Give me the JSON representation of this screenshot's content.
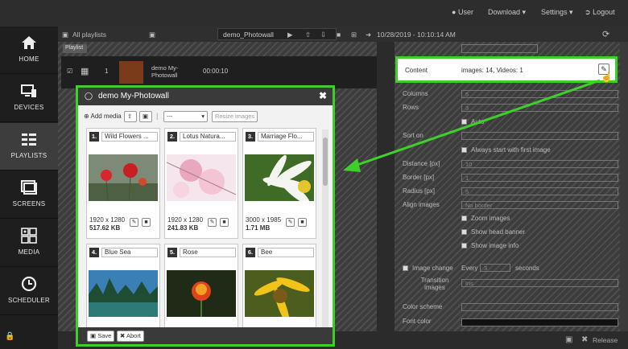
{
  "topnav": {
    "user": "User",
    "download": "Download",
    "settings": "Settings",
    "logout": "Logout"
  },
  "sidebar": [
    {
      "label": "HOME",
      "icon": "home-icon"
    },
    {
      "label": "DEVICES",
      "icon": "devices-icon"
    },
    {
      "label": "PLAYLISTS",
      "icon": "playlists-icon"
    },
    {
      "label": "SCREENS",
      "icon": "screens-icon"
    },
    {
      "label": "MEDIA",
      "icon": "media-icon"
    },
    {
      "label": "SCHEDULER",
      "icon": "scheduler-icon"
    }
  ],
  "toolbar": {
    "all_playlists": "All playlists",
    "playlist_name": "demo_Photowall",
    "datetime": "10/28/2019 - 10:10:14 AM"
  },
  "playlist": {
    "tag": "Playlist",
    "row": {
      "index": "1",
      "name": "demo My-Photowall",
      "duration": "00:00:10"
    }
  },
  "content_panel": {
    "content_label": "Content",
    "content_value": "images: 14, Videos: 1",
    "fields": [
      {
        "label": "Columns",
        "value": "5"
      },
      {
        "label": "Rows",
        "value": "3"
      },
      {
        "label": "Sort on",
        "value": ""
      },
      {
        "label": "Distance [px]",
        "value": "10"
      },
      {
        "label": "Border [px]",
        "value": "1"
      },
      {
        "label": "Radius [px]",
        "value": "5"
      },
      {
        "label": "Align images",
        "value": "No border"
      }
    ],
    "checks": {
      "auto": "Auto",
      "first_image": "Always start with first image",
      "zoom": "Zoom images",
      "banner": "Show head banner",
      "info": "Show image info"
    },
    "image_change": {
      "label": "Image change",
      "every": "Every",
      "value": "3",
      "unit": "seconds"
    },
    "transition": {
      "label": "Transition images",
      "value": "Ins"
    },
    "color_scheme": "Color scheme",
    "font_color": "Font color"
  },
  "modal": {
    "title": "demo My-Photowall",
    "add_media": "Add media",
    "select_value": "---",
    "resize": "Resize images",
    "cards": [
      {
        "num": "1.",
        "title": "Wild Flowers ...",
        "dims": "1920 x 1280",
        "size": "517.62 KB"
      },
      {
        "num": "2.",
        "title": "Lotus Natura...",
        "dims": "1920 x 1280",
        "size": "241.83 KB"
      },
      {
        "num": "3.",
        "title": "Marriage Flo...",
        "dims": "3000 x 1985",
        "size": "1.71 MB"
      },
      {
        "num": "4.",
        "title": "Blue Sea",
        "dims": "",
        "size": ""
      },
      {
        "num": "5.",
        "title": "Rose",
        "dims": "",
        "size": ""
      },
      {
        "num": "6.",
        "title": "Bee",
        "dims": "",
        "size": ""
      }
    ],
    "save": "Save",
    "abort": "Abort"
  },
  "footer": {
    "release": "Release"
  },
  "colors": {
    "highlight": "#3fcf2b",
    "dark": "#2d2d2d"
  }
}
